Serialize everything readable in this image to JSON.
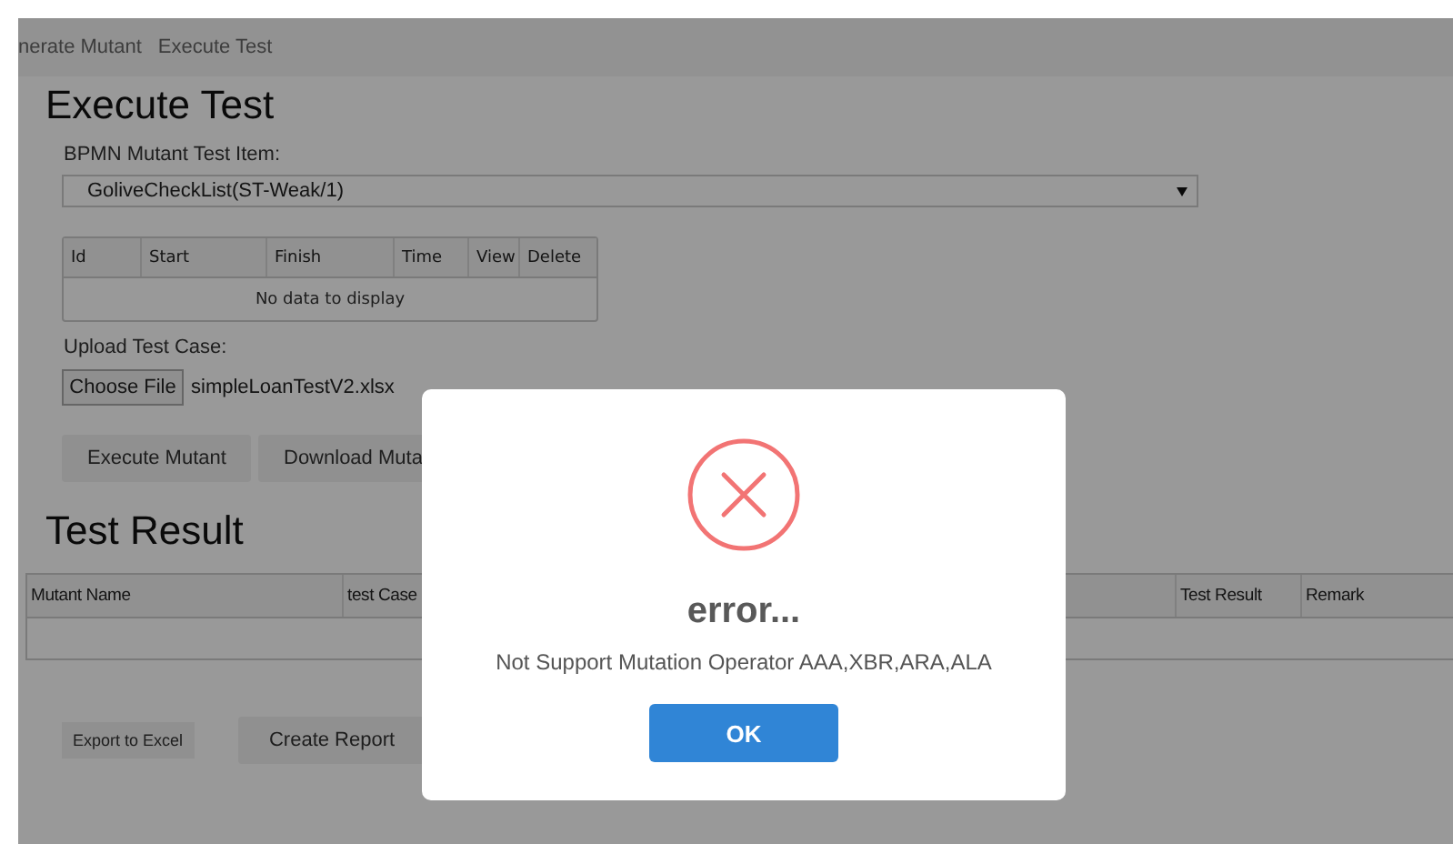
{
  "nav": [
    "nerate Mutant",
    "Execute Test"
  ],
  "execute_test": {
    "title": "Execute Test",
    "item_label": "BPMN Mutant Test Item:",
    "item_select": {
      "value": "GoliveCheckList(ST-Weak/1)"
    },
    "runs_table": {
      "columns": [
        "Id",
        "Start",
        "Finish",
        "Time",
        "View",
        "Delete"
      ],
      "empty_message": "No data to display"
    },
    "upload_label": "Upload Test Case:",
    "file_button": "Choose File",
    "file_name": "simpleLoanTestV2.xlsx",
    "buttons": [
      "Execute Mutant",
      "Download Muta"
    ]
  },
  "test_result": {
    "title": "Test Result",
    "table": {
      "columns": [
        "Mutant Name",
        "test Case",
        "Test Result",
        "Remark"
      ]
    },
    "export_button": "Export to Excel",
    "report_button": "Create Report"
  },
  "dialog": {
    "kind": "error",
    "title": "error...",
    "message": "Not Support Mutation Operator AAA,XBR,ARA,ALA",
    "button": "OK"
  }
}
